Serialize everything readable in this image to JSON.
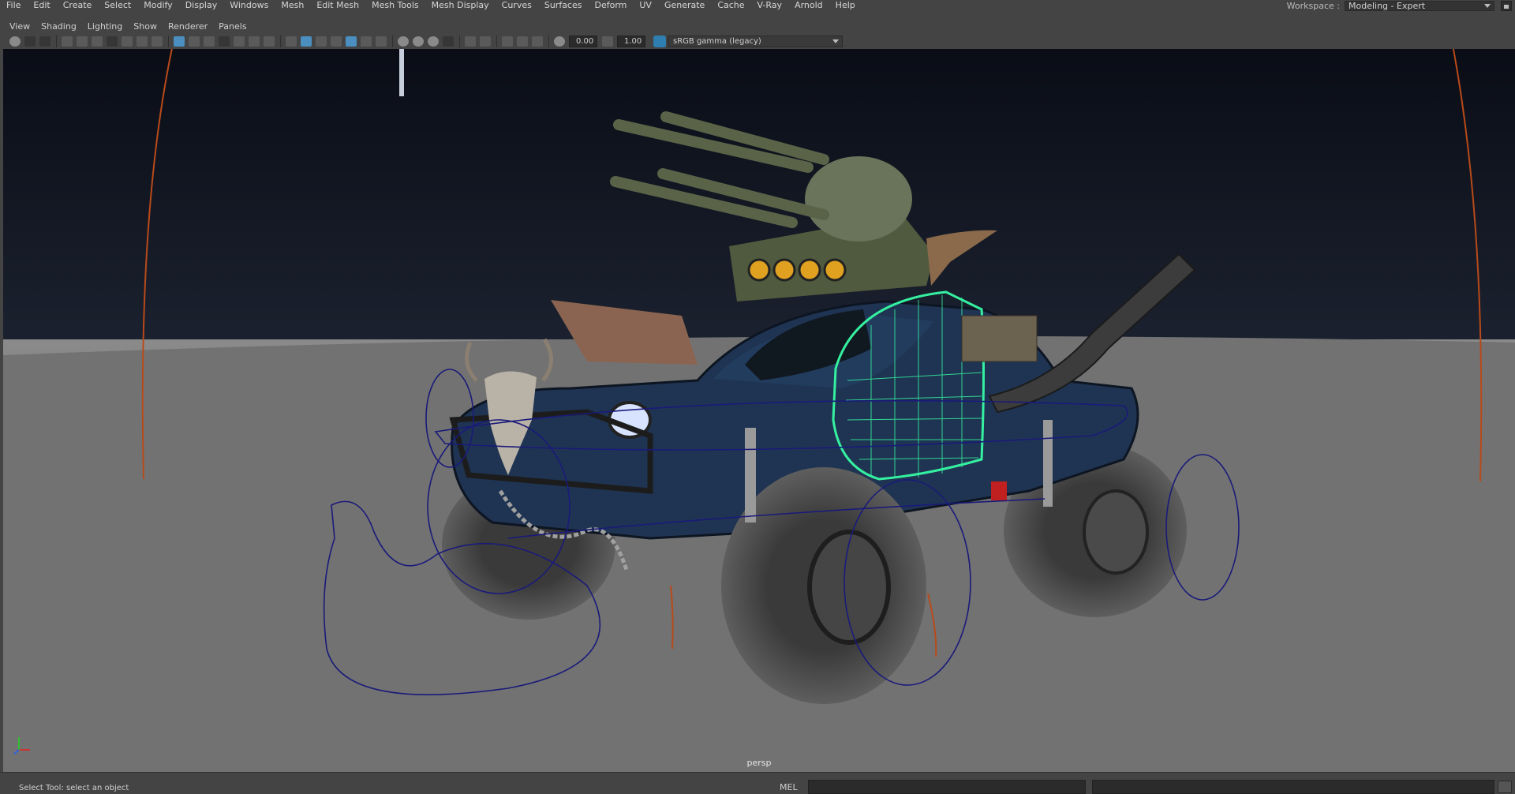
{
  "menubar": {
    "items": [
      "File",
      "Edit",
      "Create",
      "Select",
      "Modify",
      "Display",
      "Windows",
      "Mesh",
      "Edit Mesh",
      "Mesh Tools",
      "Mesh Display",
      "Curves",
      "Surfaces",
      "Deform",
      "UV",
      "Generate",
      "Cache",
      "V-Ray",
      "Arnold",
      "Help"
    ],
    "workspace_label": "Workspace :",
    "workspace_value": "Modeling - Expert"
  },
  "panel_menu": {
    "items": [
      "View",
      "Shading",
      "Lighting",
      "Show",
      "Renderer",
      "Panels"
    ]
  },
  "toolbar": {
    "exposure_value": "0.00",
    "gamma_value": "1.00",
    "color_space": "sRGB gamma (legacy)"
  },
  "viewport": {
    "camera_label": "persp"
  },
  "status": {
    "help_line": "Select Tool: select an object",
    "command_language": "MEL"
  },
  "colors": {
    "ui_background": "#444444",
    "viewport_floor": "#707070",
    "wireframe_highlight": "#35f0a0",
    "curve_control": "#1a1a7a",
    "light_rig": "#b84a1a"
  }
}
